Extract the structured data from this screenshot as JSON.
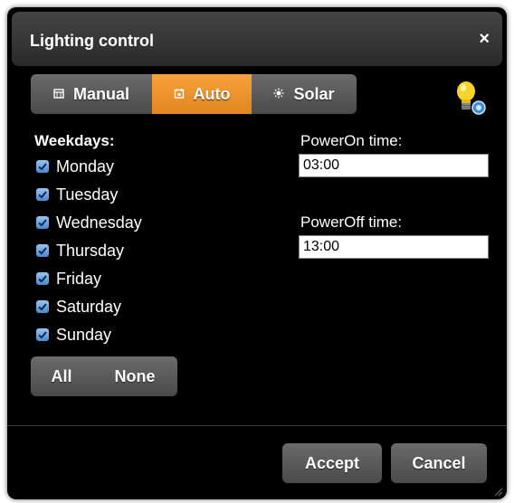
{
  "dialog": {
    "title": "Lighting control",
    "close_glyph": "×"
  },
  "modes": {
    "active": "Auto",
    "items": [
      {
        "label": "Manual",
        "icon": "calendar-grid-icon"
      },
      {
        "label": "Auto",
        "icon": "calendar-icon"
      },
      {
        "label": "Solar",
        "icon": "sun-icon"
      }
    ]
  },
  "status_icon": "lightbulb-icon",
  "weekdays": {
    "heading": "Weekdays:",
    "days": [
      {
        "label": "Monday",
        "checked": true
      },
      {
        "label": "Tuesday",
        "checked": true
      },
      {
        "label": "Wednesday",
        "checked": true
      },
      {
        "label": "Thursday",
        "checked": true
      },
      {
        "label": "Friday",
        "checked": true
      },
      {
        "label": "Saturday",
        "checked": true
      },
      {
        "label": "Sunday",
        "checked": true
      }
    ],
    "all_label": "All",
    "none_label": "None"
  },
  "power_on": {
    "label": "PowerOn time:",
    "value": "03:00"
  },
  "power_off": {
    "label": "PowerOff time:",
    "value": "13:00"
  },
  "actions": {
    "accept_label": "Accept",
    "cancel_label": "Cancel"
  },
  "colors": {
    "accent": "#f39a2f",
    "button": "#5c5c5c",
    "checkbox": "#5b93d3",
    "background": "#000000"
  }
}
